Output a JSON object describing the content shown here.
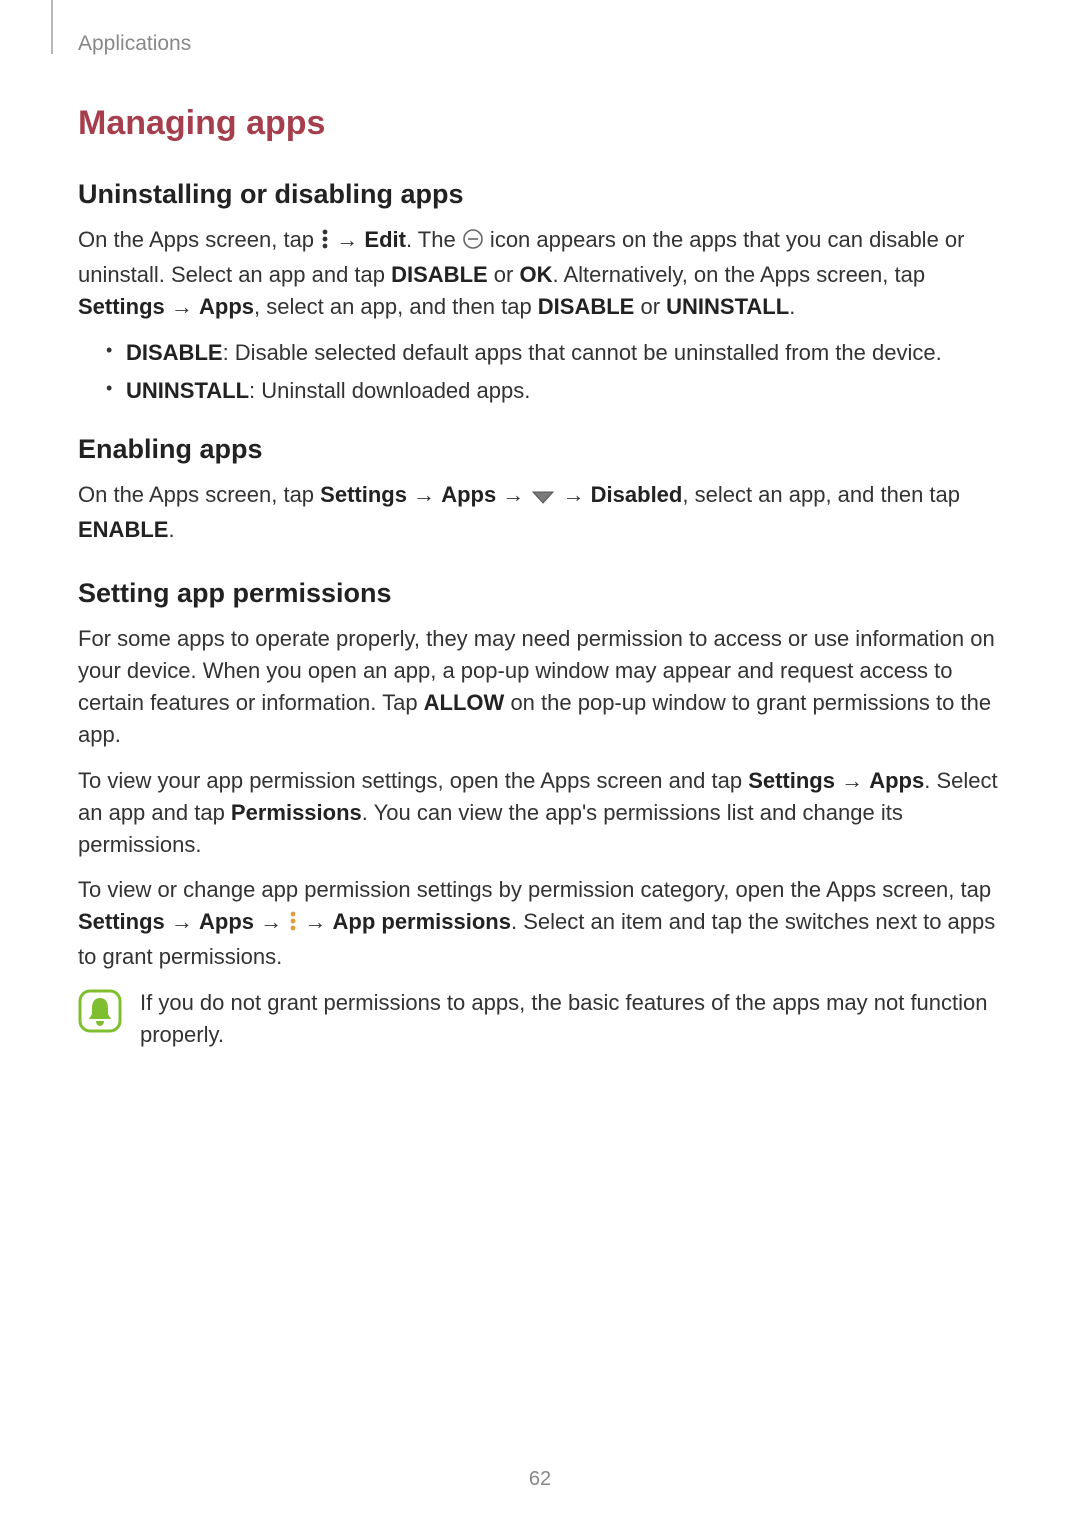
{
  "header": {
    "section": "Applications"
  },
  "title": "Managing apps",
  "sections": {
    "uninstall": {
      "heading": "Uninstalling or disabling apps",
      "p1_a": "On the Apps screen, tap ",
      "p1_b": " → ",
      "p1_edit": "Edit",
      "p1_c": ". The ",
      "p1_d": " icon appears on the apps that you can disable or uninstall. Select an app and tap ",
      "p1_disable": "DISABLE",
      "p1_or": " or ",
      "p1_ok": "OK",
      "p1_e": ". Alternatively, on the Apps screen, tap ",
      "p1_settings": "Settings",
      "p1_arrow": " → ",
      "p1_apps": "Apps",
      "p1_f": ", select an app, and then tap ",
      "p1_disable2": "DISABLE",
      "p1_or2": " or ",
      "p1_uninstall": "UNINSTALL",
      "p1_g": ".",
      "bullet1_bold": "DISABLE",
      "bullet1_text": ": Disable selected default apps that cannot be uninstalled from the device.",
      "bullet2_bold": "UNINSTALL",
      "bullet2_text": ": Uninstall downloaded apps."
    },
    "enable": {
      "heading": "Enabling apps",
      "p1_a": "On the Apps screen, tap ",
      "p1_settings": "Settings",
      "p1_arrow1": " → ",
      "p1_apps": "Apps",
      "p1_arrow2": " → ",
      "p1_arrow3": " → ",
      "p1_disabled": "Disabled",
      "p1_b": ", select an app, and then tap ",
      "p1_enable": "ENABLE",
      "p1_c": "."
    },
    "permissions": {
      "heading": "Setting app permissions",
      "p1": "For some apps to operate properly, they may need permission to access or use information on your device. When you open an app, a pop-up window may appear and request access to certain features or information. Tap ",
      "p1_allow": "ALLOW",
      "p1_b": " on the pop-up window to grant permissions to the app.",
      "p2_a": "To view your app permission settings, open the Apps screen and tap ",
      "p2_settings": "Settings",
      "p2_arrow": " → ",
      "p2_apps": "Apps",
      "p2_b": ". Select an app and tap ",
      "p2_perm": "Permissions",
      "p2_c": ". You can view the app's permissions list and change its permissions.",
      "p3_a": "To view or change app permission settings by permission category, open the Apps screen, tap ",
      "p3_settings": "Settings",
      "p3_arrow1": " → ",
      "p3_apps": "Apps",
      "p3_arrow2": " → ",
      "p3_arrow3": " → ",
      "p3_appperm": "App permissions",
      "p3_b": ". Select an item and tap the switches next to apps to grant permissions.",
      "note": "If you do not grant permissions to apps, the basic features of the apps may not function properly."
    }
  },
  "page_number": "62"
}
